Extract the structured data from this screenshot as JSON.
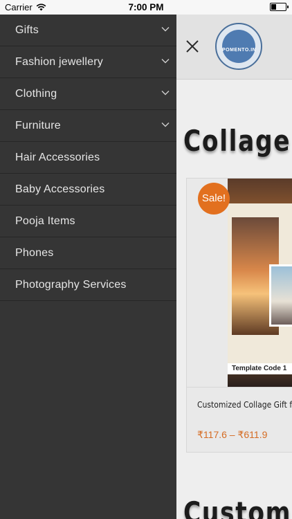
{
  "status_bar": {
    "carrier": "Carrier",
    "time": "7:00 PM"
  },
  "drawer": {
    "items": [
      {
        "label": "Gifts",
        "has_submenu": true
      },
      {
        "label": "Fashion jewellery",
        "has_submenu": true
      },
      {
        "label": "Clothing",
        "has_submenu": true
      },
      {
        "label": "Furniture",
        "has_submenu": true
      },
      {
        "label": "Hair Accessories",
        "has_submenu": false
      },
      {
        "label": "Baby Accessories",
        "has_submenu": false
      },
      {
        "label": "Pooja Items",
        "has_submenu": false
      },
      {
        "label": "Phones",
        "has_submenu": false
      },
      {
        "label": "Photography Services",
        "has_submenu": false
      }
    ]
  },
  "header": {
    "logo_text": "POMENTO.IN"
  },
  "sections": {
    "collage_title": "Collage",
    "custom_title": "Custom"
  },
  "product": {
    "sale_badge": "Sale!",
    "image_caption": "Template Code 1",
    "name": "Customized Collage Gift for l",
    "price": "₹117.6 – ₹611.9"
  },
  "colors": {
    "drawer_bg": "#353535",
    "accent": "#e2701f",
    "price": "#d56b22"
  }
}
